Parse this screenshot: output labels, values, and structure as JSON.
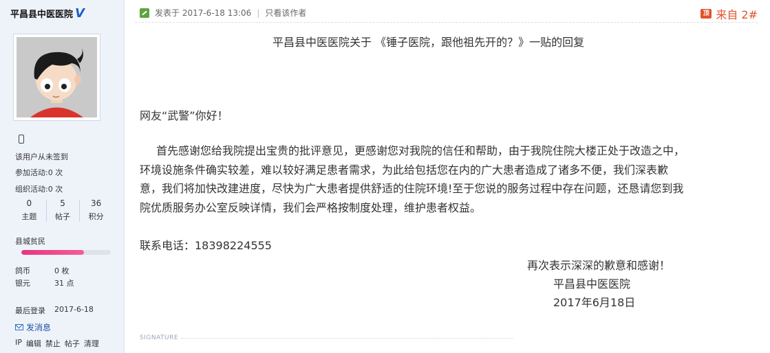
{
  "user": {
    "name": "平昌县中医医院",
    "verified_badge": "V",
    "checkin": "该用户从未签到",
    "activities_joined": "参加活动:0 次",
    "activities_organized": "组织活动:0 次",
    "stats": [
      {
        "value": "0",
        "label": "主题"
      },
      {
        "value": "5",
        "label": "帖子"
      },
      {
        "value": "36",
        "label": "积分"
      }
    ],
    "rank_title": "县城贫民",
    "rank_progress": 0.7,
    "currency": [
      {
        "label": "鸽币",
        "value": "0 枚"
      },
      {
        "label": "银元",
        "value": "31 点"
      }
    ],
    "last_login_label": "最后登录",
    "last_login": "2017-6-18",
    "send_message": "发消息",
    "admin_links": [
      "IP",
      "编辑",
      "禁止",
      "帖子",
      "清理"
    ]
  },
  "post": {
    "posted_at": "发表于 2017-6-18 13:06",
    "author_only": "只看该作者",
    "top_badge": "顶",
    "floor": "来自 2#",
    "title": "平昌县中医医院关于 《锤子医院，跟他祖先开的？》一贴的回复",
    "greeting": "网友“武警”你好！",
    "lines": [
      "首先感谢您给我院提出宝贵的批评意见，更感谢您对我院的信任和帮助，由于我院住院大楼正处于改造之中，",
      "环境设施条件确实较差，难以较好满足患者需求，为此给包括您在内的广大患者造成了诸多不便，我们深表歉",
      "意，我们将加快改建进度，尽快为广大患者提供舒适的住院环境!至于您说的服务过程中存在问题，还恳请您到我",
      "院优质服务办公室反映详情，我们会严格按制度处理，维护患者权益。"
    ],
    "contact": "联系电话：18398224555",
    "closing": "再次表示深深的歉意和感谢！",
    "signer": "平昌县中医医院",
    "date": "2017年6月18日",
    "signature_label": "SIGNATURE"
  }
}
